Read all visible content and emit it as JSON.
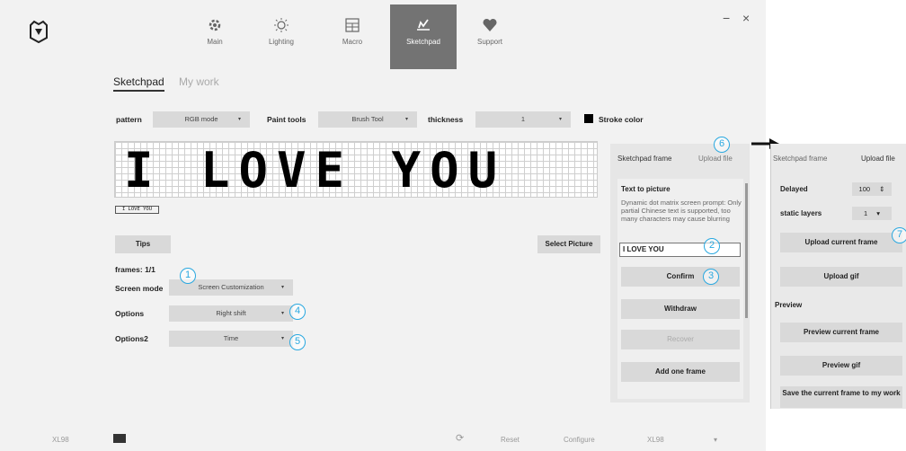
{
  "nav": {
    "tabs": [
      {
        "label": "Main",
        "icon": "gear-icon"
      },
      {
        "label": "Lighting",
        "icon": "bulb-icon"
      },
      {
        "label": "Macro",
        "icon": "grid-icon"
      },
      {
        "label": "Sketchpad",
        "icon": "sketch-icon"
      },
      {
        "label": "Support",
        "icon": "heart-icon"
      }
    ],
    "active_tab": "Sketchpad",
    "minimize": "−",
    "close": "×"
  },
  "subtabs": {
    "sketchpad": "Sketchpad",
    "mywork": "My work"
  },
  "toolbar": {
    "pattern_label": "pattern",
    "pattern_value": "RGB mode",
    "paint_label": "Paint tools",
    "paint_value": "Brush Tool",
    "thickness_label": "thickness",
    "thickness_value": "1",
    "stroke_label": "Stroke color",
    "stroke_color": "#000000",
    "arrow": "▾"
  },
  "matrix": {
    "text": "I LOVE YOU",
    "thumb": "I LOVE YOU"
  },
  "controls": {
    "tips": "Tips",
    "select_picture": "Select Picture",
    "frames": "frames: 1/1",
    "screen_mode_label": "Screen mode",
    "screen_mode_value": "Screen Customization",
    "options_label": "Options",
    "options_value": "Right shift",
    "options2_label": "Options2",
    "options2_value": "Time"
  },
  "panel": {
    "tab_frame": "Sketchpad frame",
    "tab_upload": "Upload file",
    "title": "Text to picture",
    "desc": "Dynamic dot matrix screen prompt: Only partial Chinese text is supported, too many characters may cause blurring",
    "input_value": "I LOVE YOU",
    "confirm": "Confirm",
    "withdraw": "Withdraw",
    "recover": "Recover",
    "add_frame": "Add one frame"
  },
  "callouts": [
    "1",
    "2",
    "3",
    "4",
    "5",
    "6",
    "7"
  ],
  "footer": {
    "left": "XL98",
    "reset": "Reset",
    "configure": "Configure",
    "device": "XL98",
    "arrow": "▾",
    "refresh": "⟳"
  },
  "zoom": {
    "tab_frame": "Sketchpad frame",
    "tab_upload": "Upload file",
    "delayed_label": "Delayed",
    "delayed_value": "100",
    "static_label": "static layers",
    "static_value": "1",
    "upload_frame": "Upload current frame",
    "upload_gif": "Upload gif",
    "preview_label": "Preview",
    "preview_frame": "Preview current frame",
    "preview_gif": "Preview gif",
    "save_frame": "Save the current frame to my work",
    "spin": "⇕",
    "arrow": "▾"
  },
  "accent_color": "#29a8e0"
}
